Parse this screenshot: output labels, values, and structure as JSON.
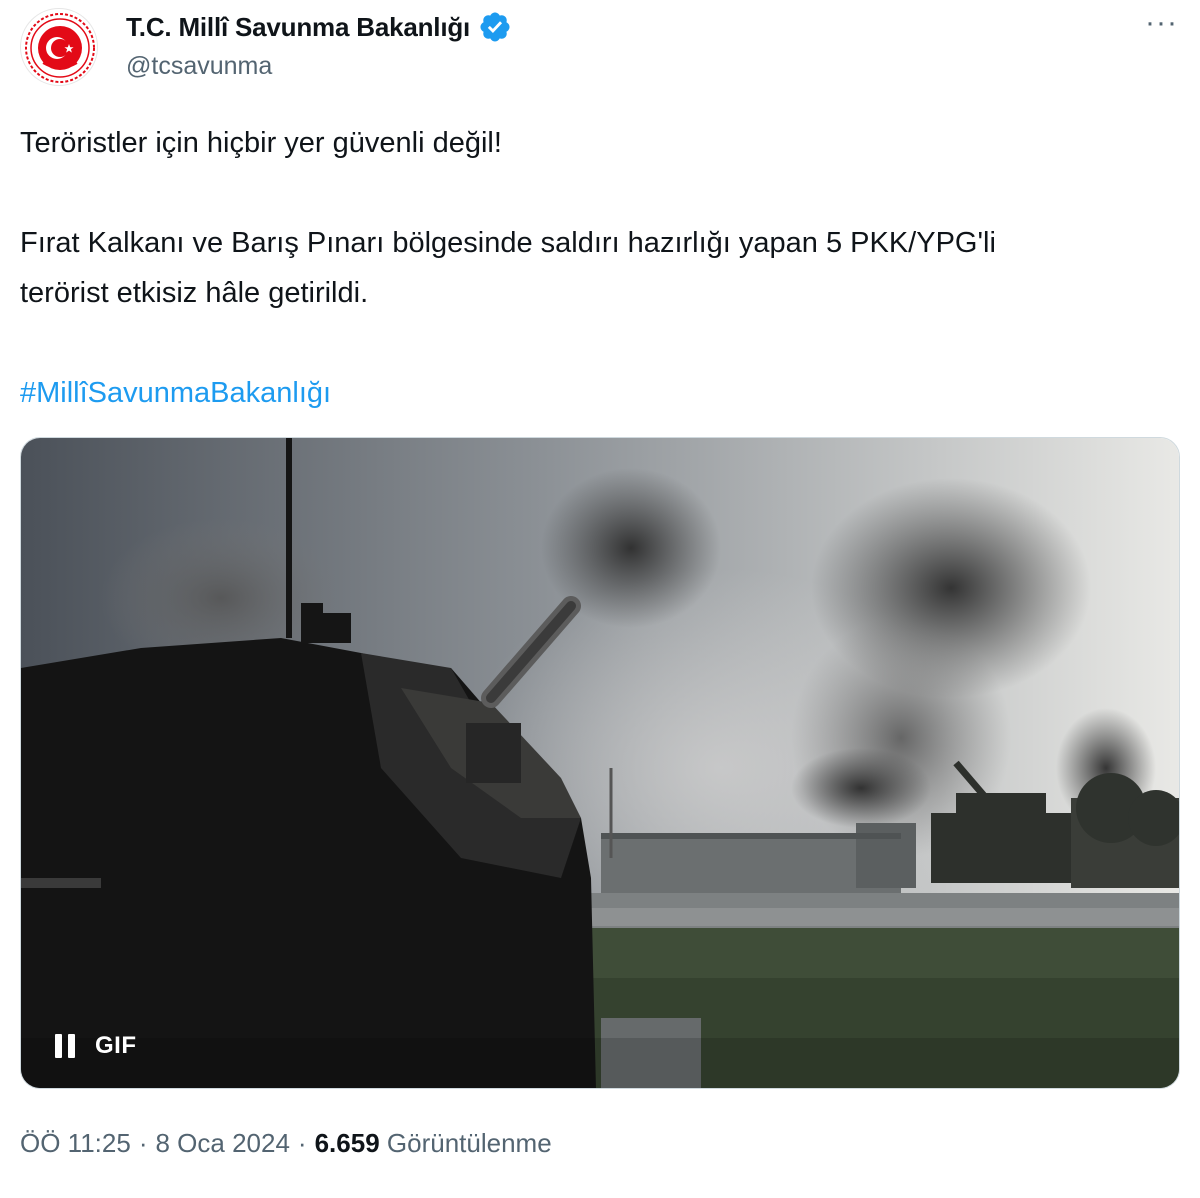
{
  "author": {
    "display_name": "T.C. Millî Savunma Bakanlığı",
    "handle": "@tcsavunma",
    "verified": true,
    "avatar_icon": "ministry-emblem-icon"
  },
  "more_icon": "more-options-icon",
  "more_label": "···",
  "tweet": {
    "line1": "Teröristler için hiçbir yer güvenli değil!",
    "line2": "Fırat Kalkanı ve Barış Pınarı bölgesinde saldırı hazırlığı yapan  5 PKK/YPG'li",
    "line3": "terörist etkisiz hâle getirildi.",
    "hashtag": "#MillîSavunmaBakanlığı"
  },
  "media": {
    "type": "gif",
    "badge": "GIF",
    "pause_icon": "pause-icon"
  },
  "meta": {
    "time": "ÖÖ 11:25",
    "date": "8 Oca 2024",
    "separator": "·",
    "views_count": "6.659",
    "views_label": "Görüntülenme"
  },
  "colors": {
    "link": "#1d9bf0",
    "secondary_text": "#536471",
    "primary_text": "#0f1419",
    "verified_badge": "#1d9bf0",
    "emblem_red": "#e30a17"
  }
}
